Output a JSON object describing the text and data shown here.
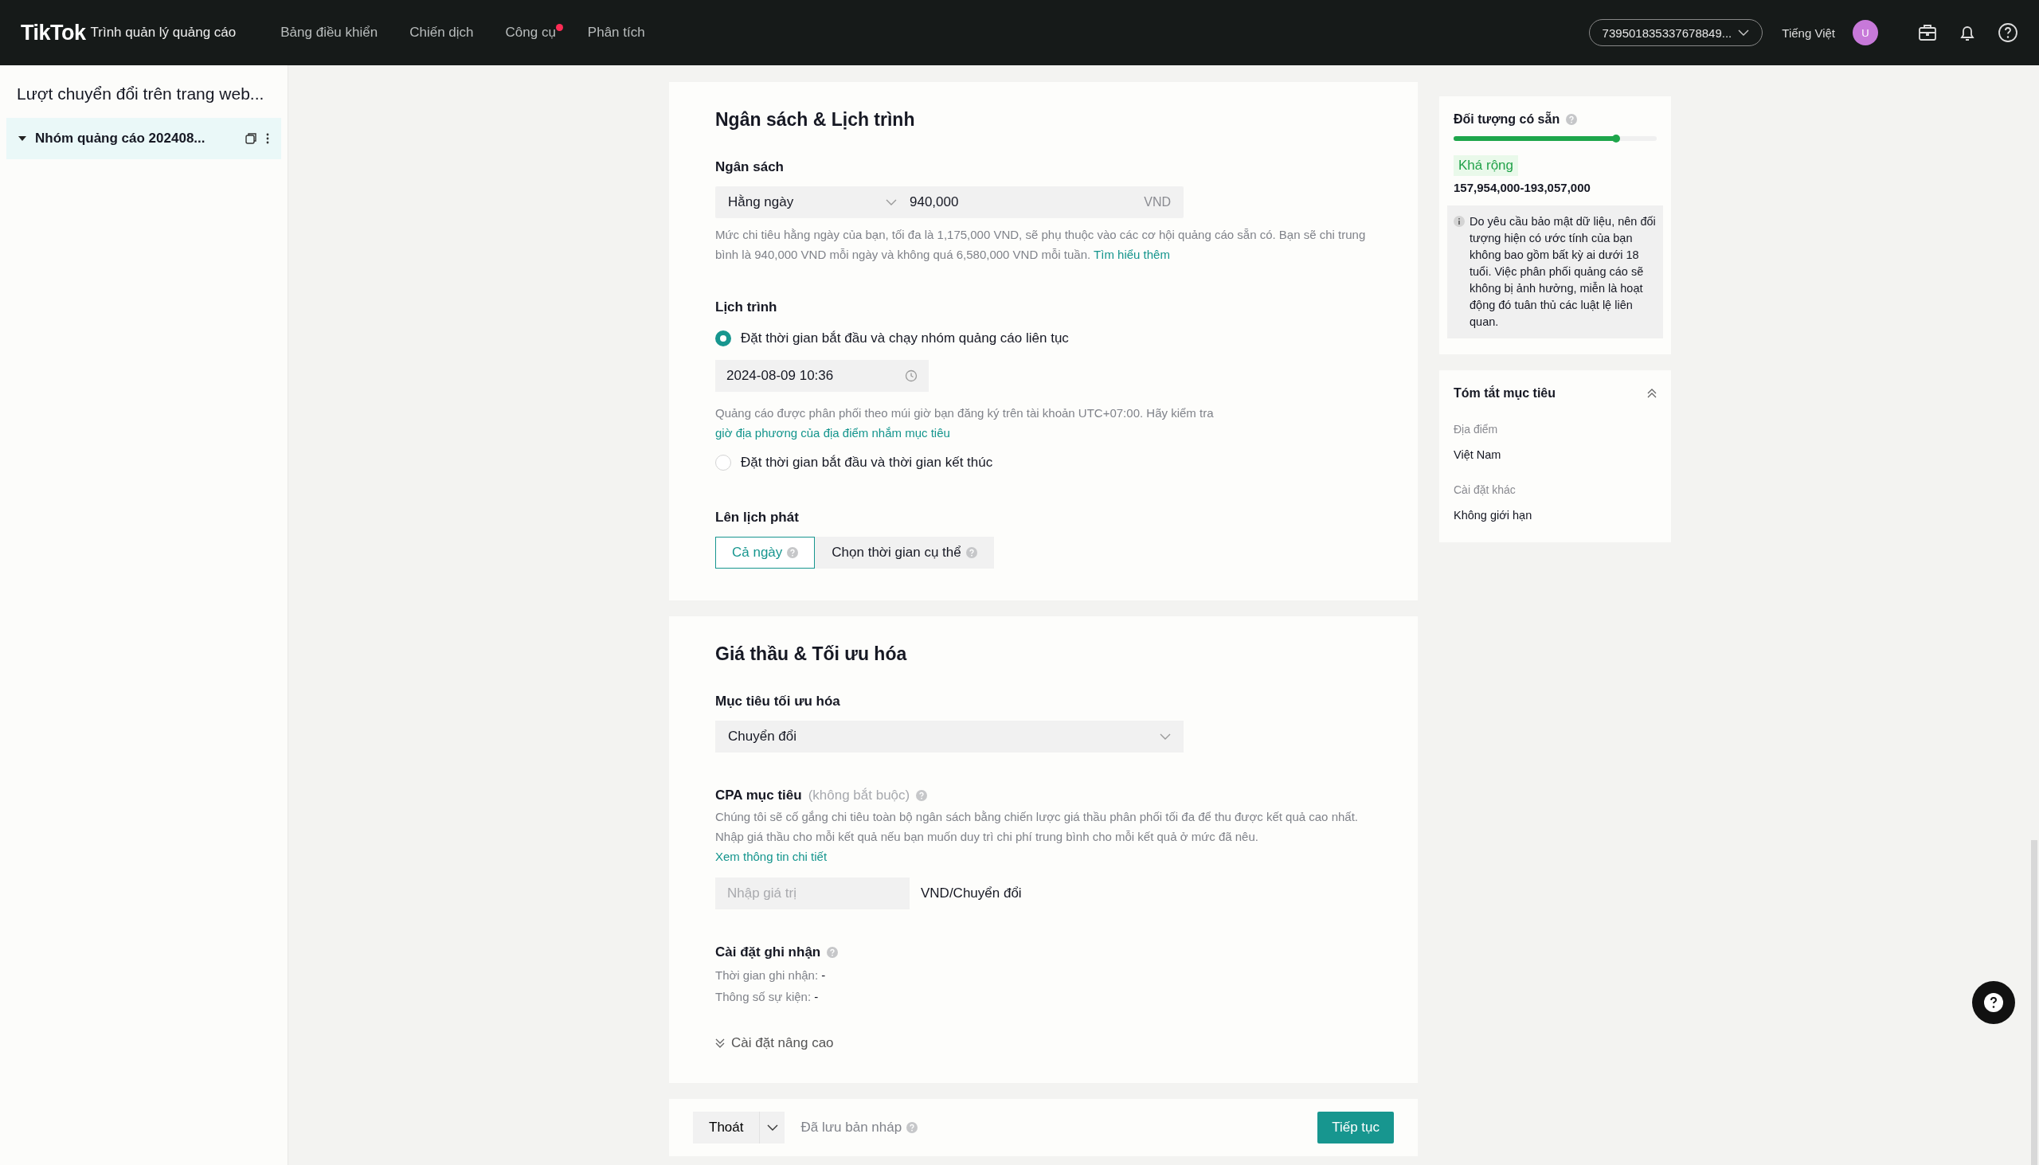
{
  "header": {
    "logo": "TikTok",
    "subtitle": "Trình quản lý quảng cáo",
    "nav": [
      {
        "label": "Bảng điều khiển",
        "selected": false,
        "notification": false
      },
      {
        "label": "Chiến dịch",
        "selected": false,
        "notification": false
      },
      {
        "label": "Công cụ",
        "selected": false,
        "notification": true
      },
      {
        "label": "Phân tích",
        "selected": false,
        "notification": false
      }
    ],
    "account": "739501835337678849...",
    "language": "Tiếng Việt",
    "avatar": "U"
  },
  "sidebar": {
    "title": "Lượt chuyển đổi trên trang web...",
    "items": [
      {
        "label": "Nhóm quảng cáo 202408...",
        "selected": true,
        "expanded": true
      }
    ]
  },
  "budget_schedule": {
    "title": "Ngân sách & Lịch trình",
    "budget_label": "Ngân sách",
    "budget_mode": "Hằng ngày",
    "budget_amount": "940,000",
    "currency": "VND",
    "budget_note": "Mức chi tiêu hằng ngày của bạn, tối đa là 1,175,000 VND, sẽ phụ thuộc vào các cơ hội quảng cáo sẵn có. Bạn sẽ chi trung bình là 940,000 VND mỗi ngày và không quá 6,580,000 VND mỗi tuần.",
    "budget_link": "Tìm hiểu thêm",
    "schedule_label": "Lịch trình",
    "schedule_options": [
      {
        "label": "Đặt thời gian bắt đầu và chạy nhóm quảng cáo liên tục",
        "selected": true,
        "start_time": "2024-08-09 10:36",
        "note": "Quảng cáo được phân phối theo múi giờ bạn đăng ký trên tài khoản UTC+07:00. Hãy kiểm tra",
        "note_link": "giờ địa phương của địa điểm nhắm mục tiêu"
      },
      {
        "label": "Đặt thời gian bắt đầu và thời gian kết thúc",
        "selected": false
      }
    ],
    "dayparting_label": "Lên lịch phát",
    "dayparting": [
      {
        "label": "Cả ngày",
        "selected": true
      },
      {
        "label": "Chọn thời gian cụ thể",
        "selected": false
      }
    ]
  },
  "bidding": {
    "title": "Giá thầu & Tối ưu hóa",
    "goal_label": "Mục tiêu tối ưu hóa",
    "goal": "Chuyển đổi",
    "cpa_label": "CPA mục tiêu",
    "cpa_optional": "(không bắt buộc)",
    "cpa_note": "Chúng tôi sẽ cố gắng chi tiêu toàn bộ ngân sách bằng chiến lược giá thầu phân phối tối đa để thu được kết quả cao nhất. Nhập giá thầu cho mỗi kết quả nếu bạn muốn duy trì chi phí trung bình cho mỗi kết quả ở mức đã nêu.",
    "cpa_link": "Xem thông tin chi tiết",
    "cpa_placeholder": "Nhập giá trị",
    "cpa_unit": "VND/Chuyển đổi",
    "attribution_label": "Cài đặt ghi nhận",
    "attribution": [
      "Thời gian ghi nhận: **-**",
      "Thông số sự kiện: **-**"
    ],
    "advanced": "Cài đặt nâng cao"
  },
  "footer": {
    "exit": "Thoát",
    "saved": "Đã lưu bản nháp",
    "continue": "Tiếp tục"
  },
  "audience": {
    "title": "Đối tượng có sẵn",
    "level": 0.8,
    "rating": "Khá rộng",
    "range": "157,954,000-193,057,000",
    "notice": "Do yêu cầu bảo mật dữ liệu, nên đối tượng hiện có ước tính của bạn không bao gồm bất kỳ ai dưới 18 tuổi. Việc phân phối quảng cáo sẽ không bị ảnh hưởng, miễn là hoạt động đó tuân thủ các luật lệ liên quan."
  },
  "summary": {
    "title": "Tóm tắt mục tiêu",
    "expanded": true,
    "items": [
      {
        "label": "Địa điểm",
        "value": "Việt Nam"
      },
      {
        "label": "Cài đặt khác",
        "value": "Không giới hạn"
      }
    ]
  }
}
